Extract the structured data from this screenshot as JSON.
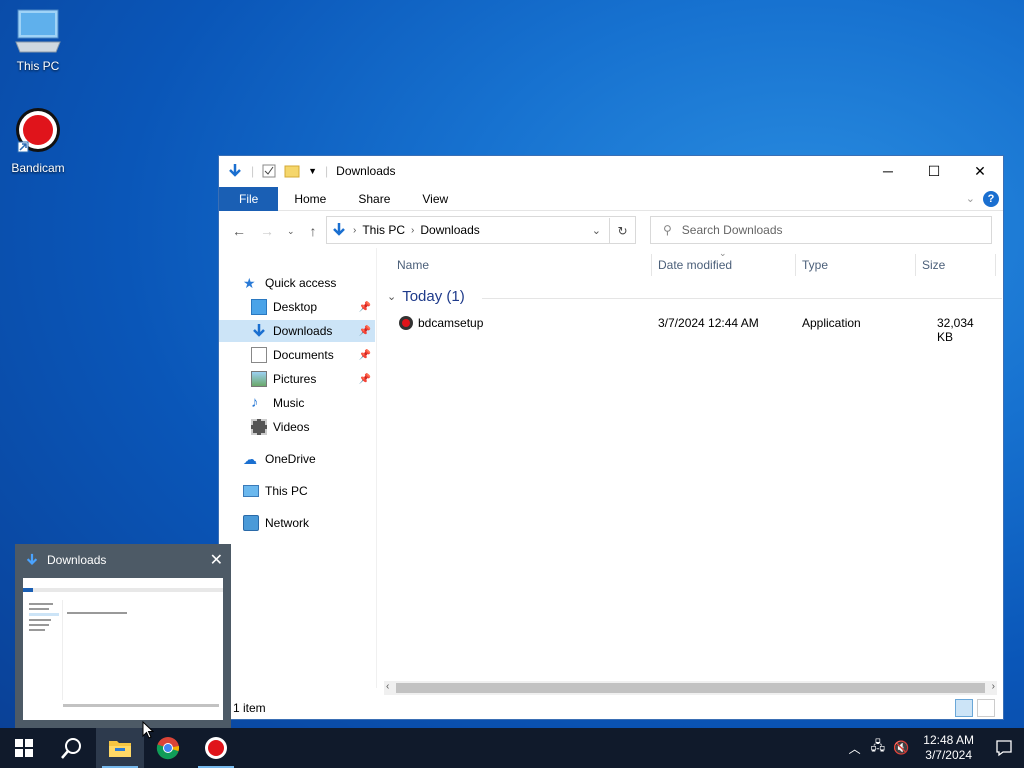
{
  "desktop": {
    "icons": [
      {
        "label": "This PC"
      },
      {
        "label": "Bandicam"
      }
    ]
  },
  "window": {
    "title": "Downloads",
    "ribbon_tabs": [
      "File",
      "Home",
      "Share",
      "View"
    ],
    "breadcrumb": [
      "This PC",
      "Downloads"
    ],
    "search_placeholder": "Search Downloads",
    "nav": {
      "quick_access": "Quick access",
      "items": [
        "Desktop",
        "Downloads",
        "Documents",
        "Pictures",
        "Music",
        "Videos"
      ],
      "onedrive": "OneDrive",
      "this_pc": "This PC",
      "network": "Network"
    },
    "columns": [
      "Name",
      "Date modified",
      "Type",
      "Size"
    ],
    "group_label": "Today (1)",
    "files": [
      {
        "name": "bdcamsetup",
        "date": "3/7/2024 12:44 AM",
        "type": "Application",
        "size": "32,034 KB"
      }
    ],
    "status": "1 item"
  },
  "thumbnail": {
    "title": "Downloads"
  },
  "taskbar": {
    "time": "12:48 AM",
    "date": "3/7/2024"
  },
  "colors": {
    "accent": "#1a5fb4",
    "selection": "#cce4f7",
    "taskbar": "#101a2b"
  }
}
